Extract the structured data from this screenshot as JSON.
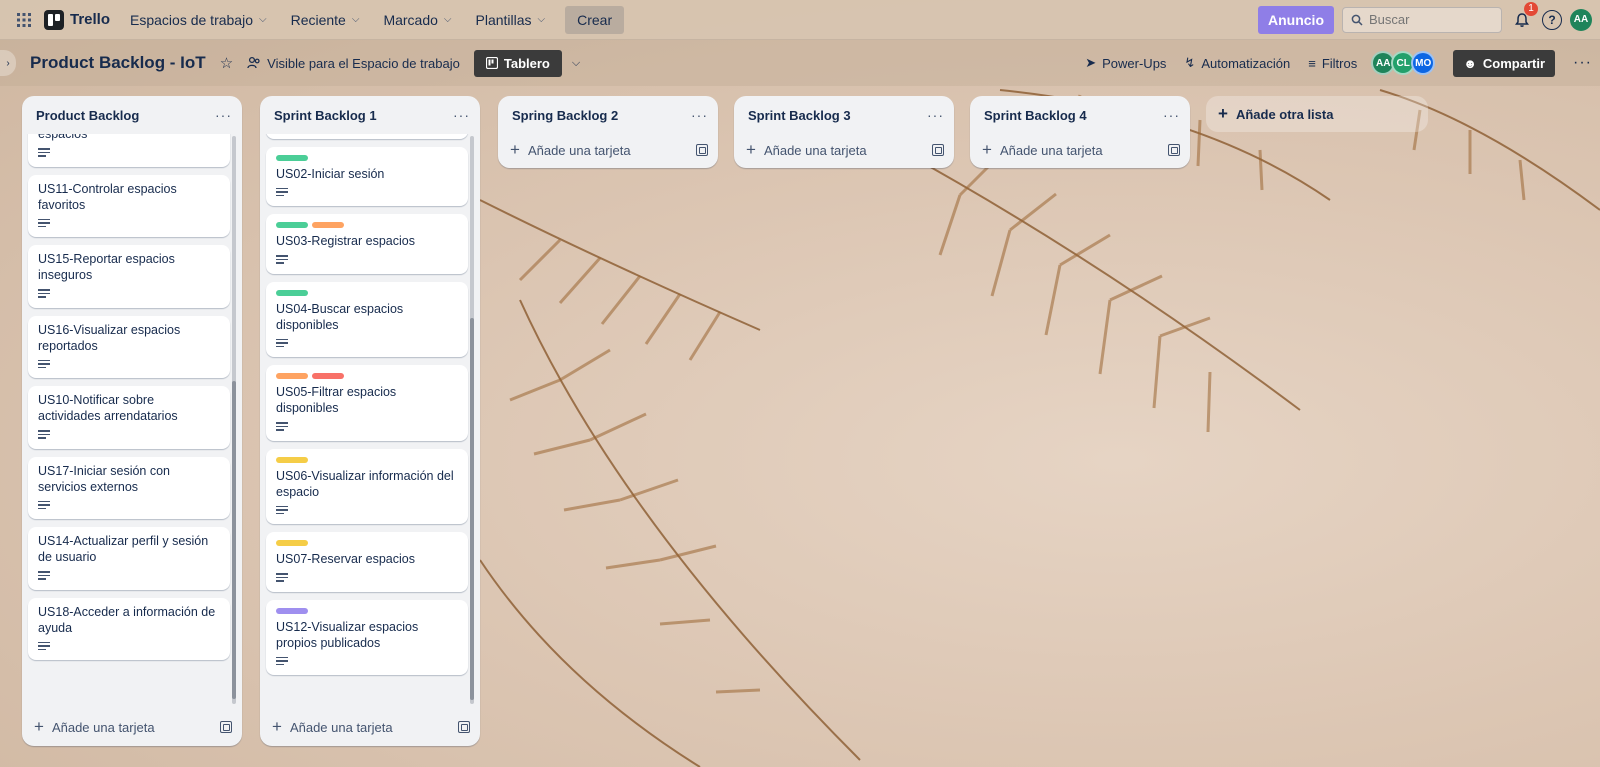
{
  "topnav": {
    "brand": "Trello",
    "menus": [
      {
        "label": "Espacios de trabajo"
      },
      {
        "label": "Reciente"
      },
      {
        "label": "Marcado"
      },
      {
        "label": "Plantillas"
      }
    ],
    "create_label": "Crear",
    "anuncio_label": "Anuncio",
    "search_placeholder": "Buscar",
    "notif_count": "1",
    "user_initials": "AA"
  },
  "board": {
    "title": "Product Backlog - IoT",
    "visibility": "Visible para el Espacio de trabajo",
    "view_label": "Tablero",
    "powerups_label": "Power-Ups",
    "automation_label": "Automatización",
    "filters_label": "Filtros",
    "members": [
      "AA",
      "CL",
      "MO"
    ],
    "share_label": "Compartir",
    "add_list_label": "Añade otra lista"
  },
  "lists": [
    {
      "title": "Product Backlog",
      "add_card_label": "Añade una tarjeta",
      "cards": [
        {
          "title": "espacios",
          "labels": []
        },
        {
          "title": "US11-Controlar espacios favoritos",
          "labels": []
        },
        {
          "title": "US15-Reportar espacios inseguros",
          "labels": []
        },
        {
          "title": "US16-Visualizar espacios reportados",
          "labels": []
        },
        {
          "title": "US10-Notificar sobre actividades arrendatarios",
          "labels": []
        },
        {
          "title": "US17-Iniciar sesión con servicios externos",
          "labels": []
        },
        {
          "title": "US14-Actualizar perfil y sesión de usuario",
          "labels": []
        },
        {
          "title": "US18-Acceder a información de ayuda",
          "labels": []
        }
      ]
    },
    {
      "title": "Sprint Backlog 1",
      "add_card_label": "Añade una tarjeta",
      "cards": [
        {
          "title": "",
          "labels": []
        },
        {
          "title": "US02-Iniciar sesión",
          "labels": [
            "#4bce97"
          ]
        },
        {
          "title": "US03-Registrar espacios",
          "labels": [
            "#4bce97",
            "#fea362"
          ]
        },
        {
          "title": "US04-Buscar espacios disponibles",
          "labels": [
            "#4bce97"
          ]
        },
        {
          "title": "US05-Filtrar espacios disponibles",
          "labels": [
            "#fea362",
            "#f87168"
          ]
        },
        {
          "title": "US06-Visualizar información del espacio",
          "labels": [
            "#f5cd47"
          ]
        },
        {
          "title": "US07-Reservar espacios",
          "labels": [
            "#f5cd47"
          ]
        },
        {
          "title": "US12-Visualizar espacios propios publicados",
          "labels": [
            "#9f8fef"
          ]
        }
      ]
    },
    {
      "title": "Spring Backlog 2",
      "add_card_label": "Añade una tarjeta",
      "cards": []
    },
    {
      "title": "Sprint Backlog 3",
      "add_card_label": "Añade una tarjeta",
      "cards": []
    },
    {
      "title": "Sprint Backlog 4",
      "add_card_label": "Añade una tarjeta",
      "cards": []
    }
  ],
  "colors": {
    "anuncio": "#8f7ee7",
    "list_bg": "#f1f2f4",
    "avatar_green": "#1f845a",
    "avatar_blue": "#0c66e4"
  }
}
